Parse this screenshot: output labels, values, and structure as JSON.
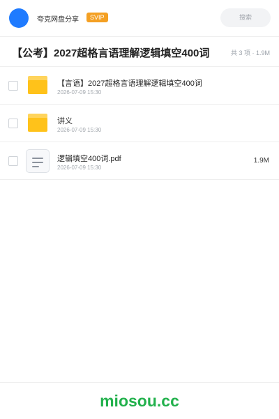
{
  "header": {
    "username": "夸克网盘分享",
    "badge": "SVIP",
    "search_placeholder": "搜索"
  },
  "folder": {
    "title": "【公考】2027超格言语理解逻辑填空400词",
    "meta": "共 3 项 · 1.9M"
  },
  "files": [
    {
      "name": "【言语】2027超格言语理解逻辑填空400词",
      "date": "2026-07-09 15:30",
      "size": "",
      "icon": "folder-icon"
    },
    {
      "name": "讲义",
      "date": "2026-07-09 15:30",
      "size": "",
      "icon": "folder-icon"
    },
    {
      "name": "逻辑填空400词.pdf",
      "date": "2026-07-09 15:30",
      "size": "1.9M",
      "icon": "document-icon"
    }
  ],
  "footer": {
    "brand": "miosou.cc"
  },
  "colors": {
    "accent": "#1f7bff",
    "svip": "#f4a023",
    "folder": "#ffc21a",
    "brand": "#22b14c"
  }
}
